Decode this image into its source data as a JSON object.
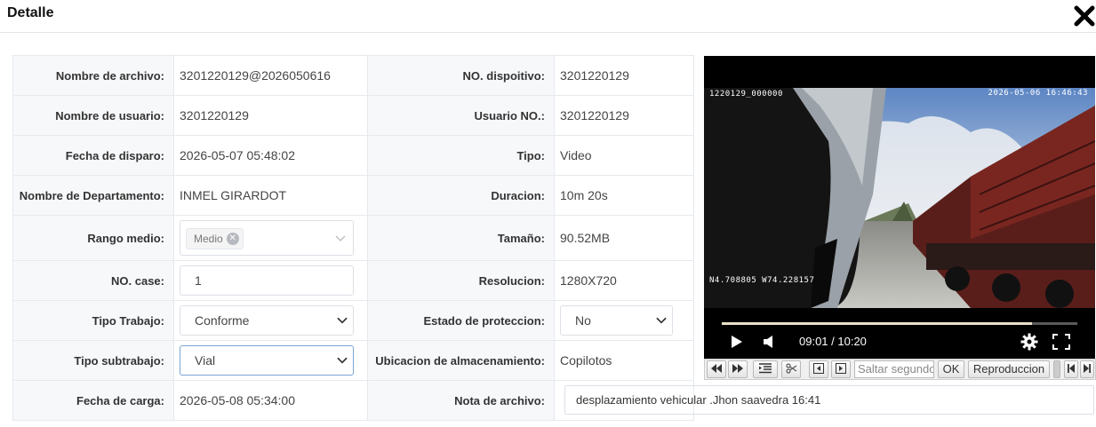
{
  "header": {
    "title": "Detalle"
  },
  "left": [
    {
      "label": "Nombre de archivo:",
      "value": "3201220129@2026050616"
    },
    {
      "label": "Nombre de usuario:",
      "value": "3201220129"
    },
    {
      "label": "Fecha de disparo:",
      "value": "2026-05-07 05:48:02"
    },
    {
      "label": "Nombre de Departamento:",
      "value": "INMEL GIRARDOT"
    },
    {
      "label": "Rango medio:",
      "tag": "Medio"
    },
    {
      "label": "NO. case:",
      "value": "1"
    },
    {
      "label": "Tipo Trabajo:",
      "value": "Conforme"
    },
    {
      "label": "Tipo subtrabajo:",
      "value": "Vial"
    },
    {
      "label": "Fecha de carga:",
      "value": "2026-05-08 05:34:00"
    }
  ],
  "right": [
    {
      "label": "NO. dispoitivo:",
      "value": "3201220129"
    },
    {
      "label": "Usuario NO.:",
      "value": "3201220129"
    },
    {
      "label": "Tipo:",
      "value": "Video"
    },
    {
      "label": "Duracion:",
      "value": "10m 20s"
    },
    {
      "label": "Tamaño:",
      "value": "90.52MB"
    },
    {
      "label": "Resolucion:",
      "value": "1280X720"
    },
    {
      "label": "Estado de proteccion:",
      "value": "No"
    },
    {
      "label": "Ubicacion de almacenamiento:",
      "value": "Copilotos"
    },
    {
      "label": "Nota de archivo:",
      "value": "desplazamiento vehicular .Jhon saavedra 16:41"
    }
  ],
  "video": {
    "osd_top_left": "1220129_000000",
    "osd_top_right": "2026-05-06 16:46:43",
    "osd_coords": "N4.708805 W74.228157",
    "time": "09:01 / 10:20",
    "progress": 0.872
  },
  "toolbar": {
    "seek_placeholder": "Saltar segundos",
    "ok_label": "OK",
    "playback_label": "Reproduccion"
  }
}
